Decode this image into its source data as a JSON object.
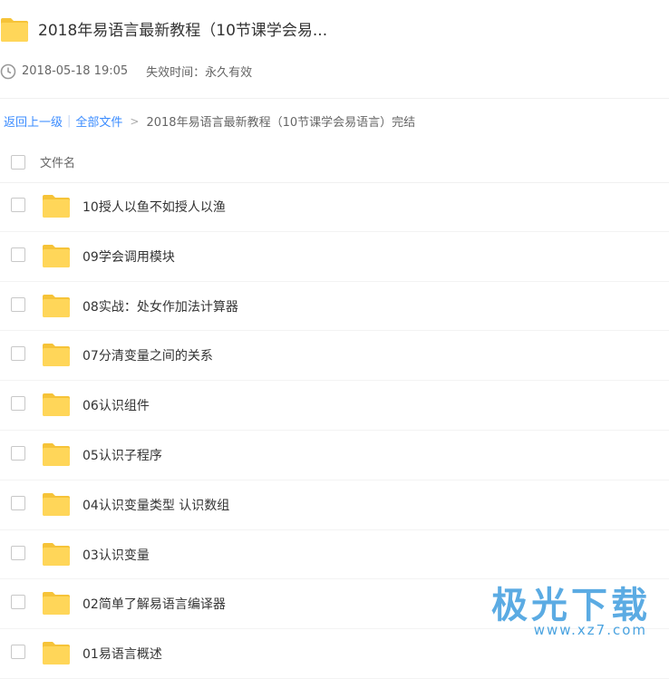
{
  "header": {
    "title": "2018年易语言最新教程（10节课学会易...",
    "date": "2018-05-18 19:05",
    "expire": "失效时间：永久有效"
  },
  "breadcrumb": {
    "back": "返回上一级",
    "sep": "|",
    "all_files": "全部文件",
    "arrow": ">",
    "current": "2018年易语言最新教程（10节课学会易语言）完结"
  },
  "list": {
    "column_name": "文件名",
    "items": [
      {
        "name": "10授人以鱼不如授人以渔"
      },
      {
        "name": "09学会调用模块"
      },
      {
        "name": "08实战：处女作加法计算器"
      },
      {
        "name": "07分清变量之间的关系"
      },
      {
        "name": "06认识组件"
      },
      {
        "name": "05认识子程序"
      },
      {
        "name": "04认识变量类型 认识数组"
      },
      {
        "name": "03认识变量"
      },
      {
        "name": "02简单了解易语言编译器"
      },
      {
        "name": "01易语言概述"
      }
    ]
  },
  "watermark": {
    "main": "极光下载",
    "url": "www.xz7.com"
  },
  "colors": {
    "folder": "#ffd659",
    "folder_tab": "#f6c338",
    "link": "#3b8cff",
    "watermark": "#4aa3e0"
  }
}
